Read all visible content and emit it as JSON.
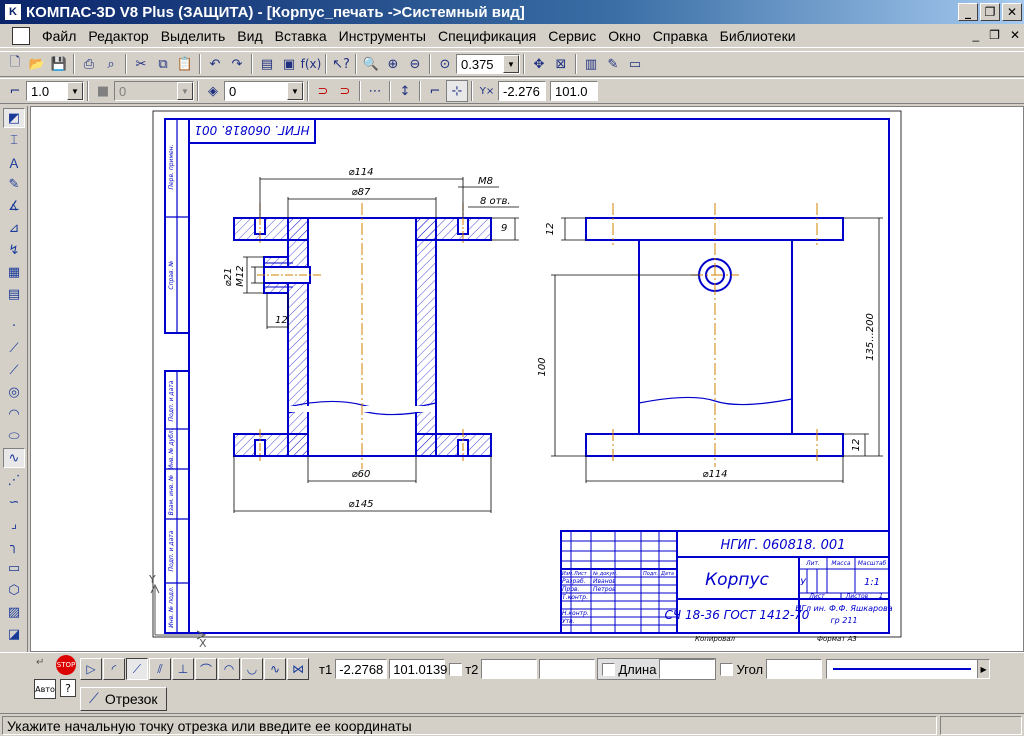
{
  "window": {
    "title": "КОМПАС-3D V8 Plus (ЗАЩИТА) - [Корпус_печать ->Системный вид]",
    "app_icon": "kompas-icon",
    "minimize": "_",
    "restore": "❐",
    "close": "✕"
  },
  "menu": {
    "items": [
      "Файл",
      "Редактор",
      "Выделить",
      "Вид",
      "Вставка",
      "Инструменты",
      "Спецификация",
      "Сервис",
      "Окно",
      "Справка",
      "Библиотеки"
    ],
    "mdi_minimize": "_",
    "mdi_restore": "❐",
    "mdi_close": "✕"
  },
  "toolbar1": {
    "zoom_value": "0.375"
  },
  "toolbar2": {
    "line_scale": "1.0",
    "layer_value": "0",
    "style_value": "0",
    "coord_x": "-2.276",
    "coord_y": "101.0"
  },
  "drawing": {
    "doc_code_mirrored": "НГИГ. 060818. 001",
    "dims": {
      "d114_top": "⌀114",
      "d87": "⌀87",
      "m8": "M8",
      "holes": "8 отв.",
      "t9": "9",
      "d21": "⌀21",
      "m12": "M12",
      "t12a": "12",
      "d60": "⌀60",
      "d145": "⌀145",
      "r12_top": "12",
      "r100": "100",
      "r135": "135...200",
      "r12_bot": "12",
      "d114_bot": "⌀114"
    },
    "side_labels": [
      "Перв. примен.",
      "Справ. №",
      "Подп. и дата",
      "Инв. № дубл.",
      "Взам. инв. №",
      "Подп. и дата",
      "Инв. № подл."
    ],
    "stamp": {
      "code": "НГИГ. 060818. 001",
      "name": "Корпус",
      "material": "СЧ 18-36 ГОСТ 1412-70",
      "org_line1": "НГл ин. Ф.Ф. Яшкарова",
      "org_line2": "гр 211",
      "lit": "Лит.",
      "mass": "Масса",
      "scale": "Масштаб",
      "lit_value": "У",
      "scale_value": "1:1",
      "sheet": "Лист",
      "sheets": "Листов",
      "sheets_value": "1",
      "rows": [
        "Изм.",
        "Лист",
        "№ докум.",
        "Подп.",
        "Дата"
      ],
      "roles": [
        "Разраб.",
        "Пров.",
        "Т.контр.",
        "Н.контр.",
        "Утв."
      ],
      "dev_name": "Иванов",
      "check_name": "Петров",
      "copied": "Копировал",
      "format": "Формат   А3"
    }
  },
  "props": {
    "t1_label": "т1",
    "t1_x": "-2.2768",
    "t1_y": "101.0139",
    "t2_label": "т2",
    "length_label": "Длина",
    "angle_label": "Угол",
    "auto_label": "Авто",
    "tab_label": "Отрезок"
  },
  "status": {
    "message": "Укажите начальную точку отрезка или введите ее координаты"
  },
  "colors": {
    "drawing_line": "#0000cc",
    "axis_line": "#d08000",
    "title_gradient_start": "#0a246a"
  }
}
